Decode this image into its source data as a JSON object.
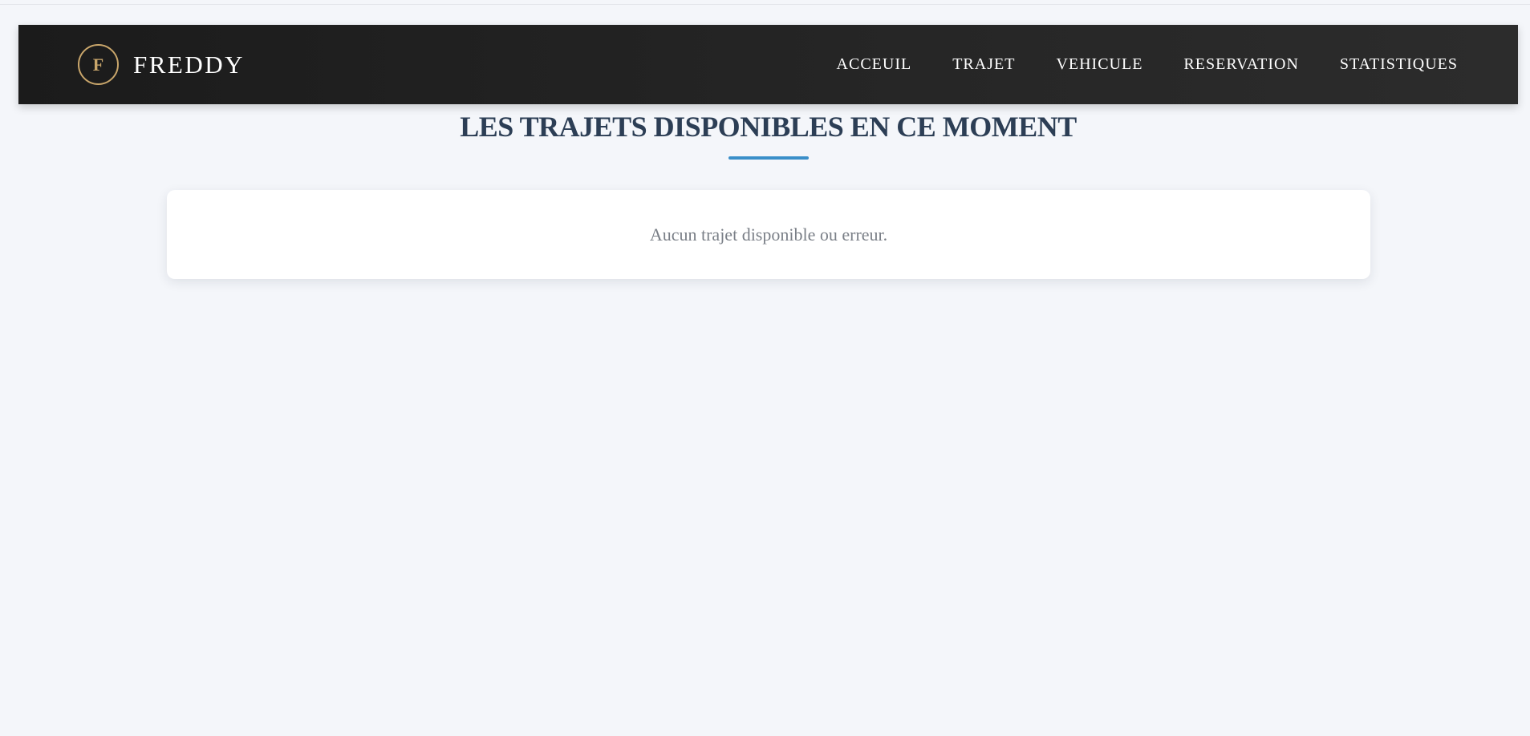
{
  "brand": {
    "initial": "F",
    "name": "FREDDY",
    "accent_color": "#c9a66b"
  },
  "nav": {
    "items": [
      {
        "label": "ACCEUIL"
      },
      {
        "label": "TRAJET"
      },
      {
        "label": "VEHICULE"
      },
      {
        "label": "RESERVATION"
      },
      {
        "label": "STATISTIQUES"
      }
    ]
  },
  "main": {
    "title": "LES TRAJETS DISPONIBLES EN CE MOMENT",
    "title_color": "#2c3e55",
    "underline_color": "#3a8fc9",
    "empty_message": "Aucun trajet disponible ou erreur."
  }
}
